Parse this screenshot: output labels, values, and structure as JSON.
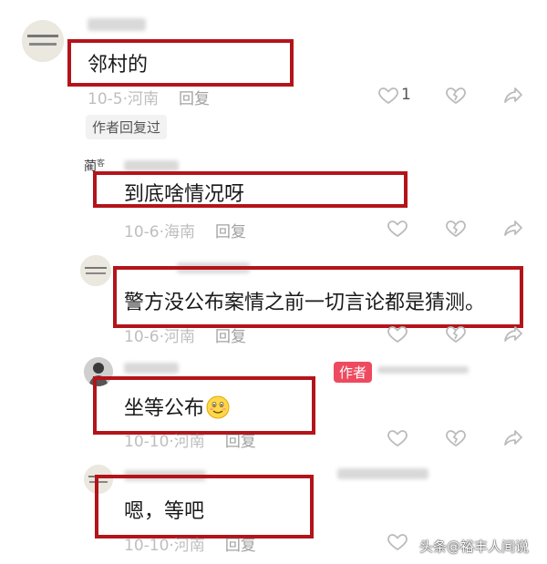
{
  "colors": {
    "highlight": "#b3141a",
    "author_badge": "#ee4a5f"
  },
  "comments": [
    {
      "text": "邻村的",
      "date": "10-5",
      "location": "河南",
      "reply": "回复",
      "likes": "1"
    },
    {
      "text": "到底啥情况呀",
      "date": "10-6",
      "location": "海南",
      "reply": "回复"
    },
    {
      "text": "警方没公布案情之前一切言论都是猜测。",
      "date": "10-6",
      "location": "河南",
      "reply": "回复"
    },
    {
      "text": "坐等公布",
      "date": "10-10",
      "location": "河南",
      "reply": "回复",
      "badge": "作者"
    },
    {
      "text": "嗯，等吧",
      "date": "10-10",
      "location": "河南",
      "reply": "回复"
    }
  ],
  "author_replied_tag": "作者回复过",
  "watermark": "头条@裕丰人间说",
  "icons": {
    "like": "heart-icon",
    "dislike": "broken-heart-icon",
    "share": "share-arrow-icon",
    "emoji": "smiling-face-emoji"
  }
}
